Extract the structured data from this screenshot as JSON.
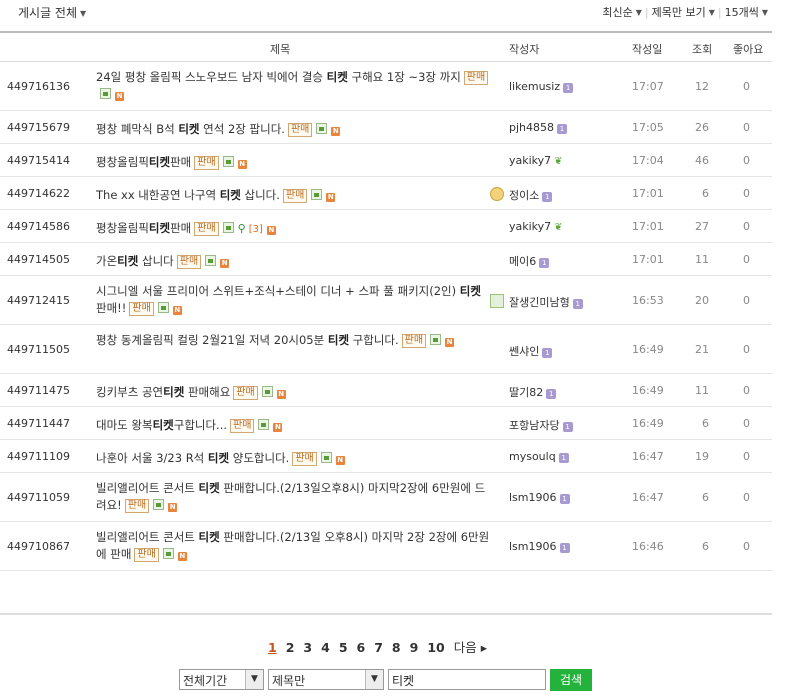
{
  "topbar": {
    "filter_label": "게시글 전체",
    "sort_label": "최신순",
    "view_label": "제목만 보기",
    "count_label": "15개씩"
  },
  "columns": {
    "title": "제목",
    "author": "작성자",
    "date": "작성일",
    "views": "조회",
    "likes": "좋아요"
  },
  "rows": [
    {
      "num": "449716136",
      "t1": "24일 평창 올림픽 스노우보드 남자 빅에어 결승 ",
      "kw": "티켓",
      "t2": " 구해요 1장 ~3장 까지",
      "sale": "판매",
      "author": "likemusiz",
      "date": "17:07",
      "views": "12",
      "likes": "0"
    },
    {
      "num": "449715679",
      "t1": "평창 폐막식 B석 ",
      "kw": "티켓",
      "t2": " 연석 2장 팝니다.",
      "sale": "판매",
      "author": "pjh4858",
      "date": "17:05",
      "views": "26",
      "likes": "0"
    },
    {
      "num": "449715414",
      "t1": "평창올림픽",
      "kw": "티켓",
      "t2": "판매",
      "sale": "판매",
      "author": "yakiky7",
      "date": "17:04",
      "views": "46",
      "likes": "0"
    },
    {
      "num": "449714622",
      "t1": "The xx 내한공연 나구역 ",
      "kw": "티켓",
      "t2": " 삽니다.",
      "sale": "판매",
      "author": "정이소",
      "date": "17:01",
      "views": "6",
      "likes": "0"
    },
    {
      "num": "449714586",
      "t1": "평창올림픽",
      "kw": "티켓",
      "t2": "판매",
      "sale": "판매",
      "comments": "[3]",
      "author": "yakiky7",
      "date": "17:01",
      "views": "27",
      "likes": "0"
    },
    {
      "num": "449714505",
      "t1": "가온",
      "kw": "티켓",
      "t2": " 삽니다",
      "sale": "판매",
      "author": "메이6",
      "date": "17:01",
      "views": "11",
      "likes": "0"
    },
    {
      "num": "449712415",
      "t1": "시그니엘 서울 프리미어 스위트+조식+스테이 디너 + 스파 풀 패키지(2인) ",
      "kw": "티켓",
      "t2": "판매!!",
      "sale": "판매",
      "author": "잘생긴미남형",
      "date": "16:53",
      "views": "20",
      "likes": "0"
    },
    {
      "num": "449711505",
      "t1": "평창 동계올림픽 컬링 2월21일 저녁 20시05분 ",
      "kw": "티켓",
      "t2": " 구합니다.",
      "sale": "판매",
      "author": "쎈샤인",
      "date": "16:49",
      "views": "21",
      "likes": "0"
    },
    {
      "num": "449711475",
      "t1": "킹키부츠 공연",
      "kw": "티켓",
      "t2": " 판매해요",
      "sale": "판매",
      "author": "딸기82",
      "date": "16:49",
      "views": "11",
      "likes": "0"
    },
    {
      "num": "449711447",
      "t1": "대마도 왕복",
      "kw": "티켓",
      "t2": "구합니다...",
      "sale": "판매",
      "author": "포항남자당",
      "date": "16:49",
      "views": "6",
      "likes": "0"
    },
    {
      "num": "449711109",
      "t1": "나훈아 서울 3/23 R석 ",
      "kw": "티켓",
      "t2": " 양도합니다.",
      "sale": "판매",
      "author": "mysoulq",
      "date": "16:47",
      "views": "19",
      "likes": "0"
    },
    {
      "num": "449711059",
      "t1": "빌리앨리어트 콘서트 ",
      "kw": "티켓",
      "t2": " 판매합니다.(2/13일오후8시) 마지막2장에 6만원에 드려요!",
      "sale": "판매",
      "author": "lsm1906",
      "date": "16:47",
      "views": "6",
      "likes": "0"
    },
    {
      "num": "449710867",
      "t1": "빌리앨리어트 콘서트 ",
      "kw": "티켓",
      "t2": " 판매합니다.(2/13일 오후8시) 마지막 2장 2장에 6만원에 판매",
      "sale": "판매",
      "author": "lsm1906",
      "date": "16:46",
      "views": "6",
      "likes": "0"
    }
  ],
  "pager": {
    "pages": [
      "1",
      "2",
      "3",
      "4",
      "5",
      "6",
      "7",
      "8",
      "9",
      "10"
    ],
    "current": "1",
    "next_label": "다음 ▸"
  },
  "search": {
    "period": "전체기간",
    "scope": "제목만",
    "query": "티켓",
    "button_label": "검색"
  },
  "colors": {
    "accent_green": "#23b33c",
    "sale_badge": "#b86c1f",
    "current_page": "#c8541c"
  }
}
